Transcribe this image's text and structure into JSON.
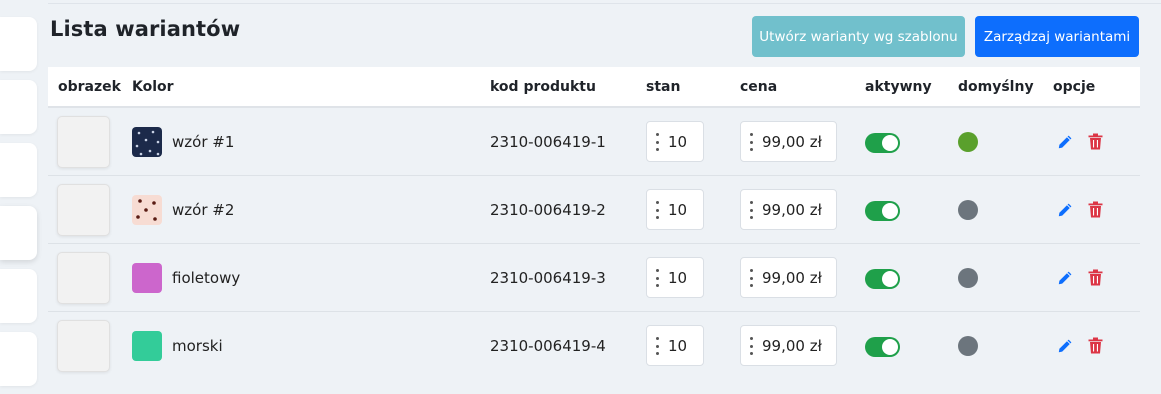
{
  "header": {
    "title": "Lista wariantów",
    "btn_template": "Utwórz warianty wg szablonu",
    "btn_manage": "Zarządzaj wariantami"
  },
  "columns": {
    "image": "obrazek",
    "color": "Kolor",
    "code": "kod produktu",
    "stock": "stan",
    "price": "cena",
    "active": "aktywny",
    "default": "domyślny",
    "options": "opcje"
  },
  "rows": [
    {
      "color": "wzór #1",
      "swatch": "navy-dots",
      "code": "2310-006419-1",
      "stock": "10",
      "price": "99,00 zł",
      "active": true,
      "is_default": true
    },
    {
      "color": "wzór #2",
      "swatch": "pink-dots",
      "code": "2310-006419-2",
      "stock": "10",
      "price": "99,00 zł",
      "active": true,
      "is_default": false
    },
    {
      "color": "fioletowy",
      "swatch": "violet",
      "code": "2310-006419-3",
      "stock": "10",
      "price": "99,00 zł",
      "active": true,
      "is_default": false
    },
    {
      "color": "morski",
      "swatch": "sea-green",
      "code": "2310-006419-4",
      "stock": "10",
      "price": "99,00 zł",
      "active": true,
      "is_default": false
    }
  ],
  "colors": {
    "primary": "#0d6efd",
    "info": "#71c0cc",
    "toggle_on": "#1fa04a",
    "default_on": "#5aa02c",
    "default_off": "#6c757d",
    "danger": "#dc3545",
    "violet": "#cc66cc",
    "sea_green": "#33cc99",
    "navy": "#1c2a4a",
    "pink": "#f7dcd3"
  }
}
